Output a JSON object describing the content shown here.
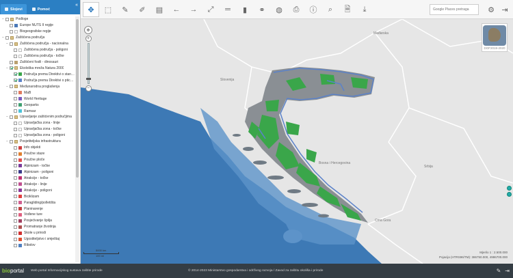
{
  "tabs": [
    {
      "label": "Slojevi",
      "active": true
    },
    {
      "label": "Pomoć",
      "active": false
    }
  ],
  "layers": [
    {
      "label": "Podloge",
      "level": 0,
      "expand": "−",
      "checked": false,
      "folder": true
    },
    {
      "label": "Europe NUTS II regije",
      "level": 1,
      "checked": false,
      "sym": "#4a78b8"
    },
    {
      "label": "Biogeografske regije",
      "level": 1,
      "checked": false,
      "sym": ""
    },
    {
      "label": "Zaštićena područja",
      "level": 0,
      "expand": "−",
      "checked": false,
      "folder": true
    },
    {
      "label": "Zaštićena područja - nacionalna",
      "level": 1,
      "expand": "−",
      "checked": false,
      "folder": true
    },
    {
      "label": "Zaštićena područja - poligoni",
      "level": 2,
      "checked": false,
      "sym": ""
    },
    {
      "label": "Zaštićena područja - točke",
      "level": 2,
      "checked": false,
      "sym": ""
    },
    {
      "label": "Zaštićeni fosili - dinosauri",
      "level": 1,
      "checked": false,
      "sym": "#b9a070"
    },
    {
      "label": "Ekološka mreža Natura 2000",
      "level": 1,
      "expand": "−",
      "checked": true,
      "folder": true
    },
    {
      "label": "Područja prema Direktivi o staništima",
      "level": 2,
      "checked": true,
      "sym": "#3aa64a"
    },
    {
      "label": "Područja prema Direktivi o pticama",
      "level": 2,
      "checked": true,
      "sym": "#5b82c9"
    },
    {
      "label": "Međunarodna proglašenja",
      "level": 1,
      "expand": "−",
      "checked": false,
      "folder": true
    },
    {
      "label": "MaB",
      "level": 2,
      "checked": false,
      "sym": "#e07a5f"
    },
    {
      "label": "World Heritage",
      "level": 2,
      "checked": false,
      "sym": "#7a5cc0"
    },
    {
      "label": "Geoparks",
      "level": 2,
      "checked": false,
      "sym": "#40a070"
    },
    {
      "label": "Ramsar",
      "level": 2,
      "checked": false,
      "sym": "#4cc3d9"
    },
    {
      "label": "Upravljanje zaštićenim područjima",
      "level": 1,
      "expand": "−",
      "checked": false,
      "folder": true
    },
    {
      "label": "Upravljačka zona - linije",
      "level": 2,
      "checked": false,
      "sym": ""
    },
    {
      "label": "Upravljačka zona - točke",
      "level": 2,
      "checked": false,
      "sym": ""
    },
    {
      "label": "Upravljačka zona - poligoni",
      "level": 2,
      "checked": false,
      "sym": ""
    },
    {
      "label": "Posjetiteljska infrastruktura",
      "level": 1,
      "expand": "−",
      "checked": false,
      "folder": true
    },
    {
      "label": "Info objekti",
      "level": 2,
      "checked": false,
      "sym": "#d04040"
    },
    {
      "label": "Poučne staze",
      "level": 2,
      "checked": false,
      "sym": "#e08030"
    },
    {
      "label": "Poučne ploče",
      "level": 2,
      "checked": false,
      "sym": "#e05050"
    },
    {
      "label": "Alpinizam - točke",
      "level": 2,
      "checked": false,
      "sym": "#7a3a9a"
    },
    {
      "label": "Alpinizam - poligoni",
      "level": 2,
      "checked": false,
      "sym": "#3a3a8a"
    },
    {
      "label": "Atrakcije - točke",
      "level": 2,
      "checked": false,
      "sym": "#c03070"
    },
    {
      "label": "Atrakcije - linije",
      "level": 2,
      "checked": false,
      "sym": "#c05090"
    },
    {
      "label": "Atrakcije - poligoni",
      "level": 2,
      "checked": false,
      "sym": "#8a3a9a"
    },
    {
      "label": "Biciklizam",
      "level": 2,
      "checked": false,
      "sym": "#e04040"
    },
    {
      "label": "Paragliding/polletišta",
      "level": 2,
      "checked": false,
      "sym": "#d06090"
    },
    {
      "label": "Planinarenje",
      "level": 2,
      "checked": false,
      "sym": "#c04040"
    },
    {
      "label": "Vođene ture",
      "level": 2,
      "checked": false,
      "sym": "#e06080"
    },
    {
      "label": "Posjećivanje špilja",
      "level": 2,
      "checked": false,
      "sym": "#a04060"
    },
    {
      "label": "Promatranje životinja",
      "level": 2,
      "checked": false,
      "sym": "#b05050"
    },
    {
      "label": "Škole u prirodi",
      "level": 2,
      "checked": false,
      "sym": "#d03030"
    },
    {
      "label": "Ugostiteljstvo i smještaj",
      "level": 2,
      "checked": false,
      "sym": "#e05030"
    },
    {
      "label": "Ribolov",
      "level": 2,
      "checked": false,
      "sym": "#5080c0"
    }
  ],
  "toolbar": {
    "buttons": [
      {
        "name": "pan-tool",
        "glyph": "✥",
        "active": true
      },
      {
        "name": "zoom-box-tool",
        "glyph": "⬚"
      },
      {
        "name": "identify-tool",
        "glyph": "✎"
      },
      {
        "name": "query-tool",
        "glyph": "✐"
      },
      {
        "name": "layer-table-tool",
        "glyph": "▤"
      },
      {
        "name": "back-arrow",
        "glyph": "←"
      },
      {
        "name": "forward-arrow",
        "glyph": "→"
      },
      {
        "name": "full-extent",
        "glyph": "⤢"
      },
      {
        "name": "measure-tool",
        "glyph": "═"
      },
      {
        "name": "erase-tool",
        "glyph": "▮"
      },
      {
        "name": "link-tool",
        "glyph": "⚭"
      },
      {
        "name": "globe-tool",
        "glyph": "◍"
      },
      {
        "name": "print-tool",
        "glyph": "⎙"
      },
      {
        "name": "info-tool",
        "glyph": "ⓘ"
      },
      {
        "name": "search-tool",
        "glyph": "⌕"
      },
      {
        "name": "document-tool",
        "glyph": "🗎"
      },
      {
        "name": "download-tool",
        "glyph": "⤓"
      }
    ],
    "search_placeholder": "Google Places pretraga"
  },
  "map": {
    "labels": [
      "Mađarska",
      "Slovenija",
      "Bosna i Hercegovina",
      "Srbija",
      "Crna Gora"
    ],
    "overview_caption": "DOF2019-2020",
    "scale_top": "5000 km",
    "scale_bottom": "100 mi",
    "scale_text": "Mjerilo 1 : 2.500.000",
    "projection_text": "Pojacija (HTRS96/TM): 386750.000, 4986700.000"
  },
  "footer": {
    "logo_a": "bio",
    "logo_b": "portal",
    "tagline": "Web portal Informacijskog sustava zaštite prirode",
    "copyright": "© 2014-2023 Ministarstvo gospodarstva i održivog razvoja / Zavod za zaštitu okoliša i prirode"
  },
  "colors": {
    "header": "#2b7fc3",
    "sea": "#3d79b5",
    "natura_habitats": "#3aa64a",
    "natura_birds": "#5b82c9",
    "footer": "#343d44"
  }
}
